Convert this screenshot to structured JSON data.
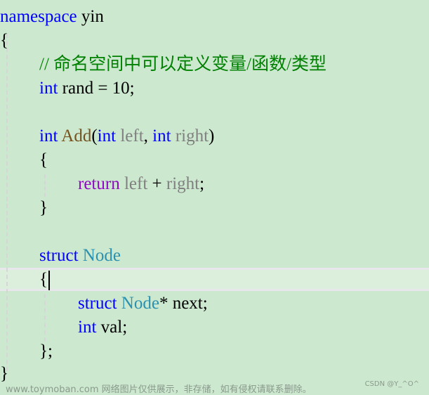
{
  "editor": {
    "lines": {
      "l1": {
        "kw": "namespace",
        "rest": " yin"
      },
      "l2": {
        "text": "{"
      },
      "l3": {
        "comment": "// 命名空间中可以定义变量/函数/类型"
      },
      "l4": {
        "kw": "int",
        "rest": " rand = 10;"
      },
      "l6": {
        "kw": "int",
        "fn": "Add",
        "p1": "(",
        "kw2": "int",
        "param1": "left",
        "comma": ", ",
        "kw3": "int",
        "param2": "right",
        "p2": ")"
      },
      "l7": {
        "text": "{"
      },
      "l8": {
        "kw": "return",
        "param1": "left",
        "op": " + ",
        "param2": "right",
        "semi": ";"
      },
      "l9": {
        "text": "}"
      },
      "l11": {
        "kw": "struct",
        "type": "Node"
      },
      "l12": {
        "text": "{"
      },
      "l13": {
        "kw": "struct",
        "type": "Node",
        "rest": "* next;"
      },
      "l14": {
        "kw": "int",
        "rest": " val;"
      },
      "l15": {
        "text": "};"
      },
      "l16": {
        "text": "}"
      }
    }
  },
  "footer": {
    "watermark": "www.toymoban.com 网络图片仅供展示，非存储，如有侵权请联系删除。",
    "credit": "CSDN @Y_^O^"
  }
}
